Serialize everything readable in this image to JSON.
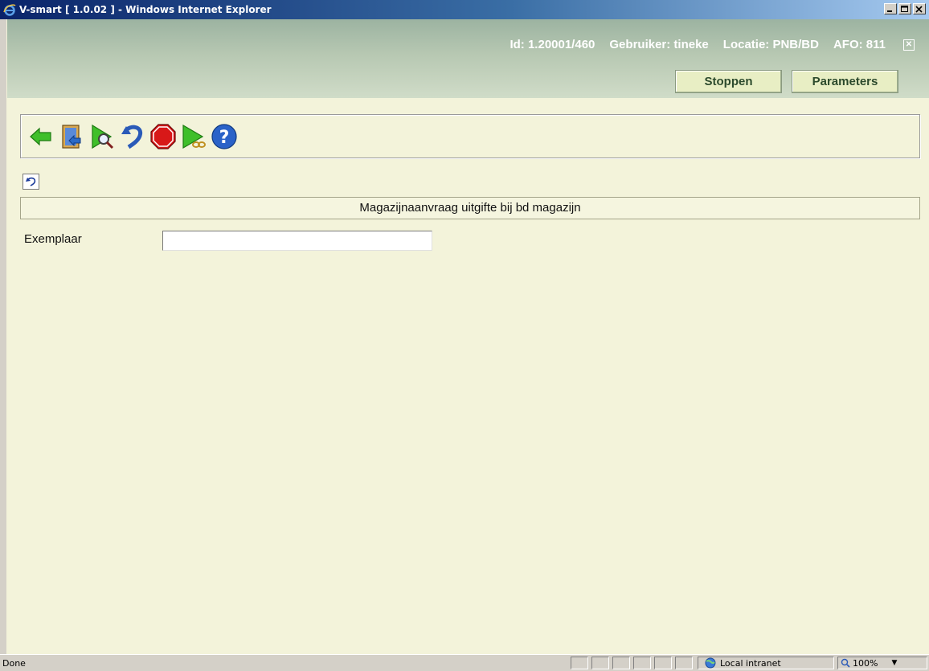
{
  "window": {
    "title": "V-smart [ 1.0.02 ] - Windows Internet Explorer",
    "icon": "ie-icon",
    "buttons": [
      "minimize-icon",
      "maximize-icon",
      "close-icon"
    ]
  },
  "header": {
    "id": "Id: 1.20001/460",
    "gebruiker": "Gebruiker: tineke",
    "locatie": "Locatie: PNB/BD",
    "afo": "AFO: 811",
    "close_symbol": "✕",
    "buttons": {
      "stoppen": "Stoppen",
      "parameters": "Parameters"
    }
  },
  "toolbar": {
    "icons": [
      "back-arrow-icon",
      "exit-door-icon",
      "search-icon",
      "undo-icon",
      "stop-icon",
      "next-link-icon",
      "help-icon"
    ]
  },
  "section": {
    "title": "Magazijnaanvraag uitgifte bij bd magazijn"
  },
  "form": {
    "exemplaar_label": "Exemplaar",
    "exemplaar_value": ""
  },
  "statusbar": {
    "status": "Done",
    "zone": "Local intranet",
    "zoom": "100%"
  },
  "colors": {
    "background": "#f3f3da",
    "header_gradient_top": "#9cb3a1",
    "button_bg": "#e8eec4"
  }
}
